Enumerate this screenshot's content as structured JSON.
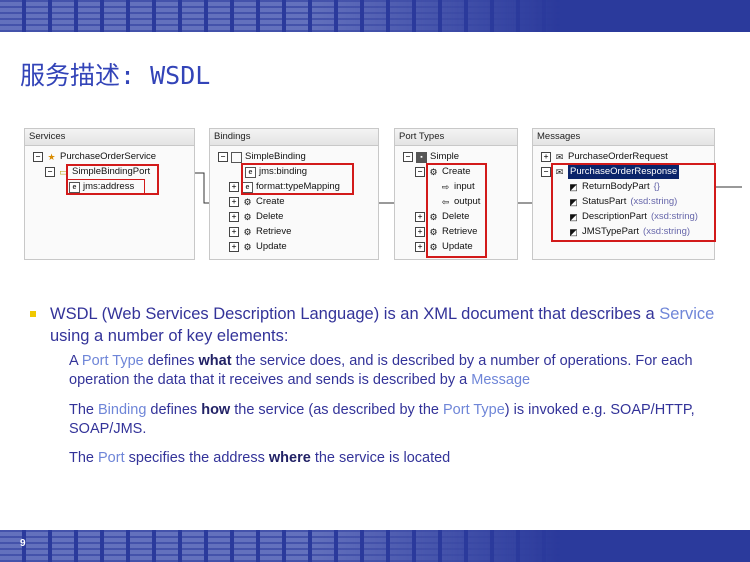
{
  "slide": {
    "title": "服务描述: WSDL",
    "page_number": "9"
  },
  "panels": {
    "services": {
      "header": "Services",
      "rows": [
        "PurchaseOrderService",
        "SimpleBindingPort",
        "jms:address"
      ]
    },
    "bindings": {
      "header": "Bindings",
      "rows": [
        "SimpleBinding",
        "jms:binding",
        "format:typeMapping",
        "Create",
        "Delete",
        "Retrieve",
        "Update"
      ]
    },
    "port_types": {
      "header": "Port Types",
      "rows": [
        "Simple",
        "Create",
        "input",
        "output",
        "Delete",
        "Retrieve",
        "Update"
      ]
    },
    "messages": {
      "header": "Messages",
      "rows": [
        "PurchaseOrderRequest",
        "PurchaseOrderResponse",
        "ReturnBodyPart",
        "StatusPart",
        "DescriptionPart",
        "JMSTypePart"
      ],
      "part_types": [
        "(xsd:string)",
        "(xsd:string)",
        "(xsd:string)"
      ]
    }
  },
  "bullet": {
    "part1": "WSDL (Web Services Description Language) is an XML document that describes a ",
    "service": "Service",
    "part2": " using a number of key elements:"
  },
  "sub1": {
    "a": "A ",
    "port_type": "Port Type",
    "b": " defines ",
    "what": "what",
    "c": " the service does, and is described by a number of operations. For each operation the data that it receives and sends  is described by a ",
    "message": "Message"
  },
  "sub2": {
    "a": "The ",
    "binding": "Binding",
    "b": " defines ",
    "how": "how",
    "c": " the service (as described by the ",
    "port_type": "Port Type",
    "d": ") is invoked e.g. SOAP/HTTP, SOAP/JMS."
  },
  "sub3": {
    "a": "The ",
    "port": "Port",
    "b": " specifies the address ",
    "where": "where",
    "c": " the service is located"
  }
}
